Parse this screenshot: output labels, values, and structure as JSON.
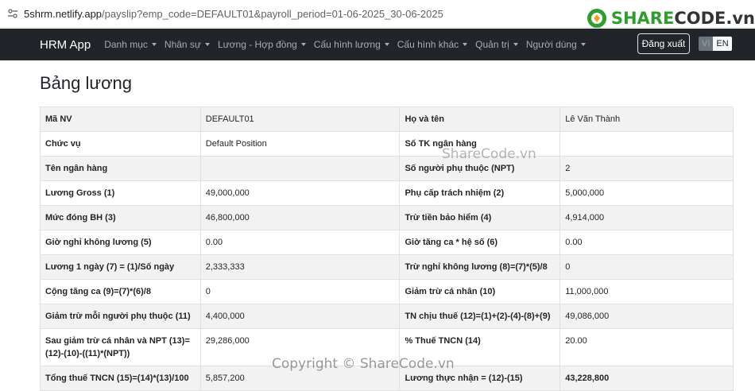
{
  "browser": {
    "url_host": "5shrm.netlify.app",
    "url_path": "/payslip?emp_code=DEFAULT01&payroll_period=01-06-2025_30-06-2025"
  },
  "watermark": {
    "logo_share": "SHARE",
    "logo_code": "CODE.vn",
    "mid_text": "ShareCode.vn",
    "bottom_text": "Copyright © ShareCode.vn"
  },
  "navbar": {
    "brand": "HRM App",
    "items": [
      {
        "label": "Danh mục"
      },
      {
        "label": "Nhân sự"
      },
      {
        "label": "Lương - Hợp đồng"
      },
      {
        "label": "Cấu hình lương"
      },
      {
        "label": "Cấu hình khác"
      },
      {
        "label": "Quản trị"
      },
      {
        "label": "Người dùng"
      }
    ],
    "logout_label": "Đăng xuất",
    "lang_vi": "VI",
    "lang_en": "EN"
  },
  "page": {
    "title": "Bảng lương"
  },
  "payslip": {
    "rows": [
      {
        "l1": "Mã NV",
        "v1": "DEFAULT01",
        "l2": "Họ và tên",
        "v2": "Lê Văn Thành"
      },
      {
        "l1": "Chức vụ",
        "v1": "Default Position",
        "l2": "Số TK ngân hàng",
        "v2": ""
      },
      {
        "l1": "Tên ngân hàng",
        "v1": "",
        "l2": "Số người phụ thuộc (NPT)",
        "v2": "2"
      },
      {
        "l1": "Lương Gross (1)",
        "v1": "49,000,000",
        "l2": "Phụ cấp trách nhiệm (2)",
        "v2": "5,000,000"
      },
      {
        "l1": "Mức đóng BH (3)",
        "v1": "46,800,000",
        "l2": "Trừ tiền bảo hiểm (4)",
        "v2": "4,914,000"
      },
      {
        "l1": "Giờ nghỉ không lương (5)",
        "v1": "0.00",
        "l2": "Giờ tăng ca * hệ số (6)",
        "v2": "0.00"
      },
      {
        "l1": "Lương 1 ngày (7) = (1)/Số ngày",
        "v1": "2,333,333",
        "l2": "Trừ nghỉ không lương (8)=(7)*(5)/8",
        "v2": "0"
      },
      {
        "l1": "Cộng tăng ca (9)=(7)*(6)/8",
        "v1": "0",
        "l2": "Giảm trừ cá nhân (10)",
        "v2": "11,000,000"
      },
      {
        "l1": "Giảm trừ mỗi người phụ thuộc (11)",
        "v1": "4,400,000",
        "l2": "TN chịu thuế (12)=(1)+(2)-(4)-(8)+(9)",
        "v2": "49,086,000"
      },
      {
        "l1": "Sau giảm trừ cá nhân và NPT (13)=(12)-(10)-((11)*(NPT))",
        "v1": "29,286,000",
        "l2": "% Thuế TNCN (14)",
        "v2": "20.00"
      },
      {
        "l1": "Tổng thuế TNCN (15)=(14)*(13)/100",
        "v1": "5,857,200",
        "l2": "Lương thực nhận = (12)-(15)",
        "v2": "43,228,800"
      }
    ]
  }
}
